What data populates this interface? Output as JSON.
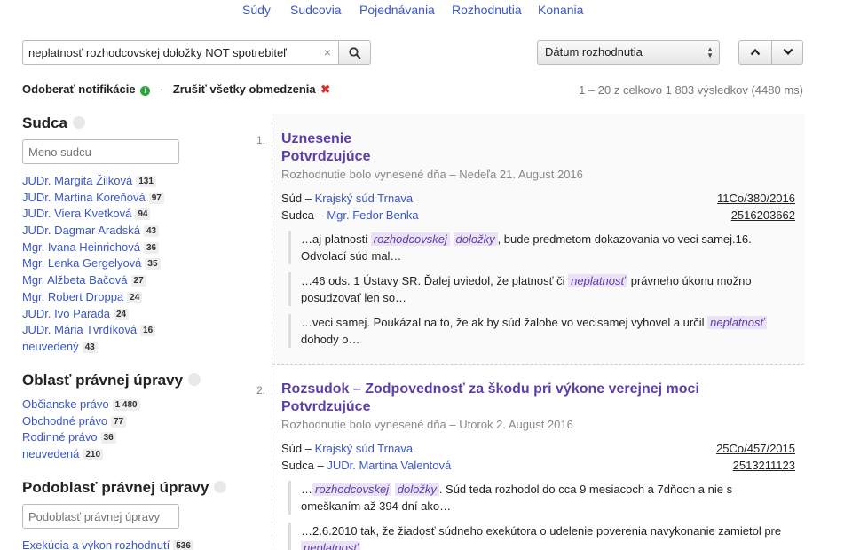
{
  "topnav": [
    {
      "label": "Súdy"
    },
    {
      "label": "Sudcovia"
    },
    {
      "label": "Pojednávania"
    },
    {
      "label": "Rozhodnutia"
    },
    {
      "label": "Konania"
    }
  ],
  "search": {
    "value": "neplatnosť rozhodcovskej doložky NOT spotrebiteľ",
    "clear_glyph": "×"
  },
  "sort": {
    "selected": "Dátum rozhodnutia"
  },
  "notify": {
    "subscribe_label": "Odoberať notifikácie",
    "clear_label": "Zrušiť všetky obmedzenia",
    "separator": "·"
  },
  "results_count": "1 – 20 z celkovo 1 803 výsledkov (4480 ms)",
  "facets": {
    "judge": {
      "title": "Sudca",
      "placeholder": "Meno sudcu",
      "items": [
        {
          "label": "JUDr. Margita Žilková",
          "count": "131"
        },
        {
          "label": "JUDr. Martina Koreňová",
          "count": "97"
        },
        {
          "label": "JUDr. Viera Kvetková",
          "count": "94"
        },
        {
          "label": "JUDr. Dagmar Aradská",
          "count": "43"
        },
        {
          "label": "Mgr. Ivana Heinrichová",
          "count": "36"
        },
        {
          "label": "Mgr. Lenka Gergelyová",
          "count": "35"
        },
        {
          "label": "Mgr. Alžbeta Bačová",
          "count": "27"
        },
        {
          "label": "Mgr. Robert Droppa",
          "count": "24"
        },
        {
          "label": "JUDr. Ivo Parada",
          "count": "24"
        },
        {
          "label": "JUDr. Mária Tvrdíková",
          "count": "16"
        },
        {
          "label": "neuvedený",
          "count": "43"
        }
      ]
    },
    "area": {
      "title": "Oblasť právnej úpravy",
      "items": [
        {
          "label": "Občianske právo",
          "count": "1 480"
        },
        {
          "label": "Obchodné právo",
          "count": "77"
        },
        {
          "label": "Rodinné právo",
          "count": "36"
        },
        {
          "label": "neuvedená",
          "count": "210"
        }
      ]
    },
    "subarea": {
      "title": "Podoblasť právnej úpravy",
      "placeholder": "Podoblasť právnej úpravy",
      "items": [
        {
          "label": "Exekúcia a výkon rozhodnutí",
          "count": "536"
        }
      ]
    }
  },
  "results": [
    {
      "num": "1.",
      "title1": "Uznesenie",
      "title2": "Potvrdzujúce",
      "date": "Rozhodnutie bolo vynesené dňa – Nedeľa 21. August 2016",
      "court_label": "Súd –",
      "court": "Krajský súd Trnava",
      "judge_label": "Sudca –",
      "judge": "Mgr. Fedor Benka",
      "file_no": "11Co/380/2016",
      "ecli": "2516203662",
      "snippets": [
        {
          "pre": "…aj platnosti ",
          "hl1": "rozhodcovskej",
          "mid": " ",
          "hl2": "doložky",
          "post": ", bude predmetom dokazovania vo veci samej.16. Odvolací súd mal…"
        },
        {
          "pre": "…46 ods. 1 Ústavy SR. Ďalej uviedol, že platnosť či ",
          "hl1": "neplatnosť",
          "mid": "",
          "hl2": "",
          "post": " právneho úkonu možno posudzovať len so…"
        },
        {
          "pre": "…veci samej. Poukázal na to, že ak by súd žalobe vo vecisamej vyhovel a určil ",
          "hl1": "neplatnosť",
          "mid": "",
          "hl2": "",
          "post": " dohody o…"
        }
      ]
    },
    {
      "num": "2.",
      "title1": "Rozsudok – Zodpovednosť za škodu pri výkone verejnej moci",
      "title2": "Potvrdzujúce",
      "date": "Rozhodnutie bolo vynesené dňa – Utorok 2. August 2016",
      "court_label": "Súd –",
      "court": "Krajský súd Trnava",
      "judge_label": "Sudca –",
      "judge": "JUDr. Martina Valentová",
      "file_no": "25Co/457/2015",
      "ecli": "2513211123",
      "snippets": [
        {
          "pre": "…",
          "hl1": "rozhodcovskej",
          "mid": " ",
          "hl2": "doložky",
          "post": ". Súd teda rozhodol do cca 9 mesiacoch a 7dňoch a nie s omeškaním až 394 dní ako…"
        },
        {
          "pre": "…2.6.2010 tak, že žiadosť súdneho exekútora o udelenie poverenia navykonanie zamietol pre ",
          "hl1": "neplatnosť",
          "mid": "",
          "hl2": "",
          "post": ""
        }
      ]
    }
  ],
  "colors": {
    "link": "#3a57c4",
    "title": "#5b3ea8",
    "highlight_bg": "#ece2f6",
    "info_green": "#2aa540",
    "close_red": "#d9302c"
  },
  "icons": {
    "search": "search-icon",
    "clear": "clear-icon",
    "up": "chevron-up-icon",
    "down": "chevron-down-icon",
    "info": "info-icon",
    "remove": "remove-icon"
  }
}
